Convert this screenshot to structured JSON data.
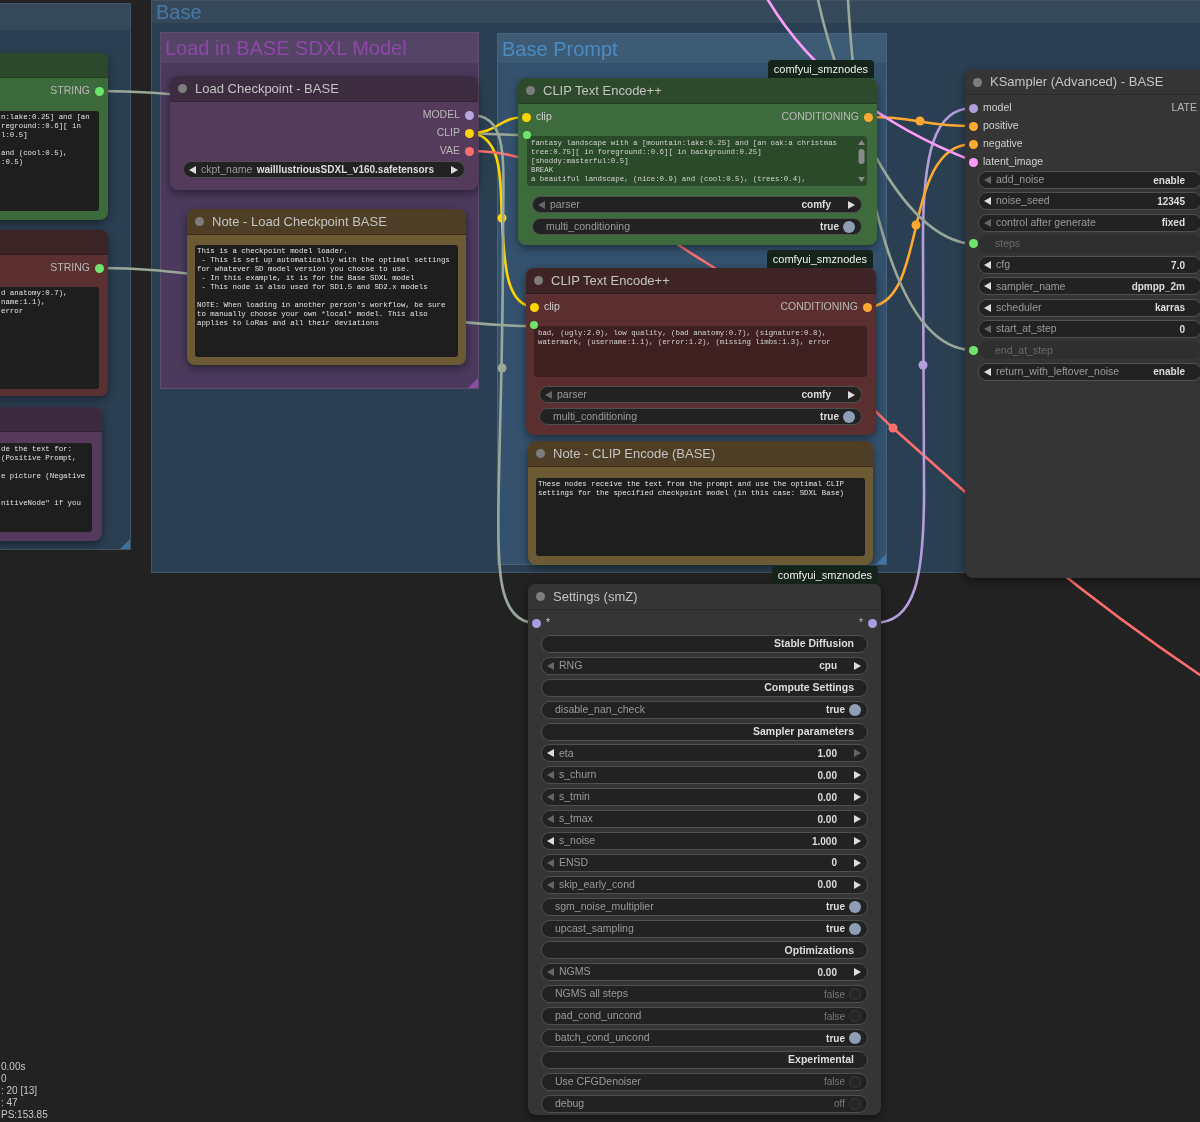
{
  "groups": [
    {
      "color": "#2b3f52",
      "resize_handle": {
        "color": "#3f6f99"
      }
    },
    {
      "title": {
        "text": "Base",
        "color": "#4779a6"
      },
      "color": "#2b3f52"
    },
    {
      "title": {
        "text": "Load in BASE SDXL Model",
        "color": "#8e47a8"
      },
      "color": "#4b3a5d",
      "resize_handle": {
        "color": "#8a4aa8"
      }
    },
    {
      "title": {
        "text": "Base Prompt",
        "color": "#4a8bc4"
      },
      "color": "#34526e",
      "resize_handle": {
        "color": "#3f74a4"
      }
    }
  ],
  "nodes": [
    {
      "color": "#3d6a3a",
      "title_bar": {
        "color": "#2c4a2b"
      },
      "outputs": [
        {
          "label": "STRING",
          "color": "#6ee66e"
        }
      ],
      "widgets": [
        {
          "kind": "textarea",
          "tinted": false,
          "value": "n:lake:0.25] and [an\nreground::0.6][ in\nl:0.5]\n\nand (cool:0.5),\n:0.5)"
        }
      ]
    },
    {
      "color": "#5a3030",
      "title_bar": {
        "color": "#3c2424"
      },
      "outputs": [
        {
          "label": "STRING",
          "color": "#6ee66e"
        }
      ],
      "widgets": [
        {
          "kind": "textarea",
          "tinted": false,
          "value": "d anatomy:0.7),\nname:1.1),\nerror"
        }
      ]
    },
    {
      "color": "#553a5b",
      "title_bar": {
        "color": "#3e2a40"
      },
      "widgets": [
        {
          "kind": "textarea",
          "tinted": false,
          "value": "de the text for:\n(Positive Prompt,\n\ne picture (Negative\n\n\nnitiveNode\" if you"
        }
      ]
    },
    {
      "title": "Load Checkpoint - BASE",
      "color": "#553b5b",
      "title_bar": {
        "color": "#3d2b40"
      },
      "outputs": [
        {
          "label": "MODEL",
          "color": "#b8a6e0"
        },
        {
          "label": "CLIP",
          "color": "#ffd500"
        },
        {
          "label": "VAE",
          "color": "#ff6e6e"
        }
      ],
      "widgets": [
        {
          "kind": "combo",
          "label": "ckpt_name",
          "value": "waiIllustriousSDXL_v160.safetensors",
          "prev_disabled": false,
          "next_disabled": false
        }
      ]
    },
    {
      "title": "Note - Load Checkpoint BASE",
      "color": "#6b5a33",
      "title_bar": {
        "color": "#4d3e25"
      },
      "widgets": [
        {
          "kind": "textarea",
          "tinted": false,
          "value": "This is a checkpoint model loader.\n - This is set up automatically with the optimal settings\nfor whatever SD model version you choose to use.\n - In this example, it is for the Base SDXL model\n - This node is also used for SD1.5 and SD2.x models\n\nNOTE: When loading in another person's workflow, be sure\nto manually choose your own *local* model. This also\napplies to LoRas and all their deviations"
        }
      ]
    },
    {
      "title": "CLIP Text Encode++",
      "badge": "comfyui_smznodes",
      "color": "#3e6b3b",
      "title_bar": {
        "color": "#2d4b2c"
      },
      "inputs": [
        {
          "label": "clip",
          "color": "#ffd500"
        }
      ],
      "outputs": [
        {
          "label": "CONDITIONING",
          "color": "#ffa931"
        }
      ],
      "widgets": [
        {
          "kind": "textarea",
          "tinted": true,
          "scrollable": true,
          "color": "#6ee66e",
          "value": "fantasy landscape with a [mountain:lake:0.25] and [an oak:a christmas\ntree:0.75][ in foreground::0.6][ in background:0.25]\n[shoddy:masterful:0.5]\nBREAK\na beautiful landscape, (nice:0.9) and (cool:0.5), (trees:0.4),"
        },
        {
          "kind": "combo",
          "label": "parser",
          "value": "comfy",
          "prev_disabled": true,
          "next_disabled": false
        },
        {
          "kind": "toggle",
          "label": "multi_conditioning",
          "value": "true",
          "on": true
        }
      ]
    },
    {
      "title": "CLIP Text Encode++",
      "badge": "comfyui_smznodes",
      "color": "#5b2f2f",
      "title_bar": {
        "color": "#3e2424"
      },
      "inputs": [
        {
          "label": "clip",
          "color": "#ffd500"
        }
      ],
      "outputs": [
        {
          "label": "CONDITIONING",
          "color": "#ffa931"
        }
      ],
      "widgets": [
        {
          "kind": "textarea",
          "tinted": true,
          "color": "#6ee66e",
          "value": "bad, (ugly:2.0), low quality, (bad anatomy:0.7), (signature:0.8),\nwatermark, (username:1.1), (error:1.2), (missing limbs:1.3), error"
        },
        {
          "kind": "combo",
          "label": "parser",
          "value": "comfy",
          "prev_disabled": true,
          "next_disabled": false
        },
        {
          "kind": "toggle",
          "label": "multi_conditioning",
          "value": "true",
          "on": true
        }
      ]
    },
    {
      "title": "Note - CLIP Encode (BASE)",
      "color": "#6b5a33",
      "title_bar": {
        "color": "#4d3e25"
      },
      "widgets": [
        {
          "kind": "textarea",
          "tinted": false,
          "value": "These nodes receive the text from the prompt and use the optimal CLIP\nsettings for the specified checkpoint model (in this case: SDXL Base)"
        }
      ]
    },
    {
      "title": "Settings (smZ)",
      "badge": "comfyui_smznodes",
      "color": "#353535",
      "title_bar": {
        "color": "#353535"
      },
      "inputs": [
        {
          "label": "*",
          "color": "#a99ee0"
        }
      ],
      "outputs": [
        {
          "label": "*",
          "color": "#a99ee0"
        }
      ],
      "widgets": [
        {
          "kind": "header",
          "label": "Stable Diffusion"
        },
        {
          "kind": "combo",
          "label": "RNG",
          "value": "cpu",
          "prev_disabled": true,
          "next_disabled": false
        },
        {
          "kind": "header",
          "label": "Compute Settings"
        },
        {
          "kind": "toggle",
          "label": "disable_nan_check",
          "value": "true",
          "on": true
        },
        {
          "kind": "header",
          "label": "Sampler parameters"
        },
        {
          "kind": "number",
          "label": "eta",
          "value": "1.00",
          "prev_disabled": false,
          "next_disabled": true
        },
        {
          "kind": "number",
          "label": "s_churn",
          "value": "0.00",
          "prev_disabled": true,
          "next_disabled": false
        },
        {
          "kind": "number",
          "label": "s_tmin",
          "value": "0.00",
          "prev_disabled": true,
          "next_disabled": false
        },
        {
          "kind": "number",
          "label": "s_tmax",
          "value": "0.00",
          "prev_disabled": true,
          "next_disabled": false
        },
        {
          "kind": "number",
          "label": "s_noise",
          "value": "1.000",
          "prev_disabled": false,
          "next_disabled": false
        },
        {
          "kind": "number",
          "label": "ENSD",
          "value": "0",
          "prev_disabled": true,
          "next_disabled": false
        },
        {
          "kind": "number",
          "label": "skip_early_cond",
          "value": "0.00",
          "prev_disabled": true,
          "next_disabled": false
        },
        {
          "kind": "toggle",
          "label": "sgm_noise_multiplier",
          "value": "true",
          "on": true
        },
        {
          "kind": "toggle",
          "label": "upcast_sampling",
          "value": "true",
          "on": true
        },
        {
          "kind": "header",
          "label": "Optimizations"
        },
        {
          "kind": "number",
          "label": "NGMS",
          "value": "0.00",
          "prev_disabled": true,
          "next_disabled": false
        },
        {
          "kind": "toggle",
          "label": "NGMS all steps",
          "value": "false",
          "on": false
        },
        {
          "kind": "toggle",
          "label": "pad_cond_uncond",
          "value": "false",
          "on": false
        },
        {
          "kind": "toggle",
          "label": "batch_cond_uncond",
          "value": "true",
          "on": true
        },
        {
          "kind": "header",
          "label": "Experimental"
        },
        {
          "kind": "toggle",
          "label": "Use CFGDenoiser",
          "value": "false",
          "on": false
        },
        {
          "kind": "toggle",
          "label": "debug",
          "value": "off",
          "on": false
        }
      ]
    },
    {
      "title": "KSampler (Advanced) - BASE",
      "color": "#353535",
      "title_bar": {
        "color": "#353535"
      },
      "inputs": [
        {
          "label": "model",
          "color": "#b39ddb"
        },
        {
          "label": "positive",
          "color": "#ffa931"
        },
        {
          "label": "negative",
          "color": "#ffa931"
        },
        {
          "label": "latent_image",
          "color": "#ff9cf9"
        }
      ],
      "outputs": [
        {
          "label": "LATE"
        }
      ],
      "widgets": [
        {
          "kind": "combo",
          "label": "add_noise",
          "value": "enable",
          "prev_disabled": true
        },
        {
          "kind": "number",
          "label": "noise_seed",
          "value": "12345",
          "prev_disabled": false
        },
        {
          "kind": "combo",
          "label": "control after generate",
          "value": "fixed",
          "prev_disabled": true
        },
        {
          "kind": "input",
          "label": "steps",
          "color": "#6ee66e"
        },
        {
          "kind": "number",
          "label": "cfg",
          "value": "7.0",
          "prev_disabled": false
        },
        {
          "kind": "combo",
          "label": "sampler_name",
          "value": "dpmpp_2m",
          "prev_disabled": false
        },
        {
          "kind": "combo",
          "label": "scheduler",
          "value": "karras",
          "prev_disabled": false
        },
        {
          "kind": "number",
          "label": "start_at_step",
          "value": "0",
          "prev_disabled": true
        },
        {
          "kind": "input",
          "label": "end_at_step",
          "color": "#6ee66e"
        },
        {
          "kind": "combo",
          "label": "return_with_leftover_noise",
          "value": "enable",
          "prev_disabled": false
        }
      ]
    }
  ],
  "stats": [
    "0.00s",
    "0",
    ": 20 [13]",
    ": 47",
    "PS:153.85"
  ]
}
